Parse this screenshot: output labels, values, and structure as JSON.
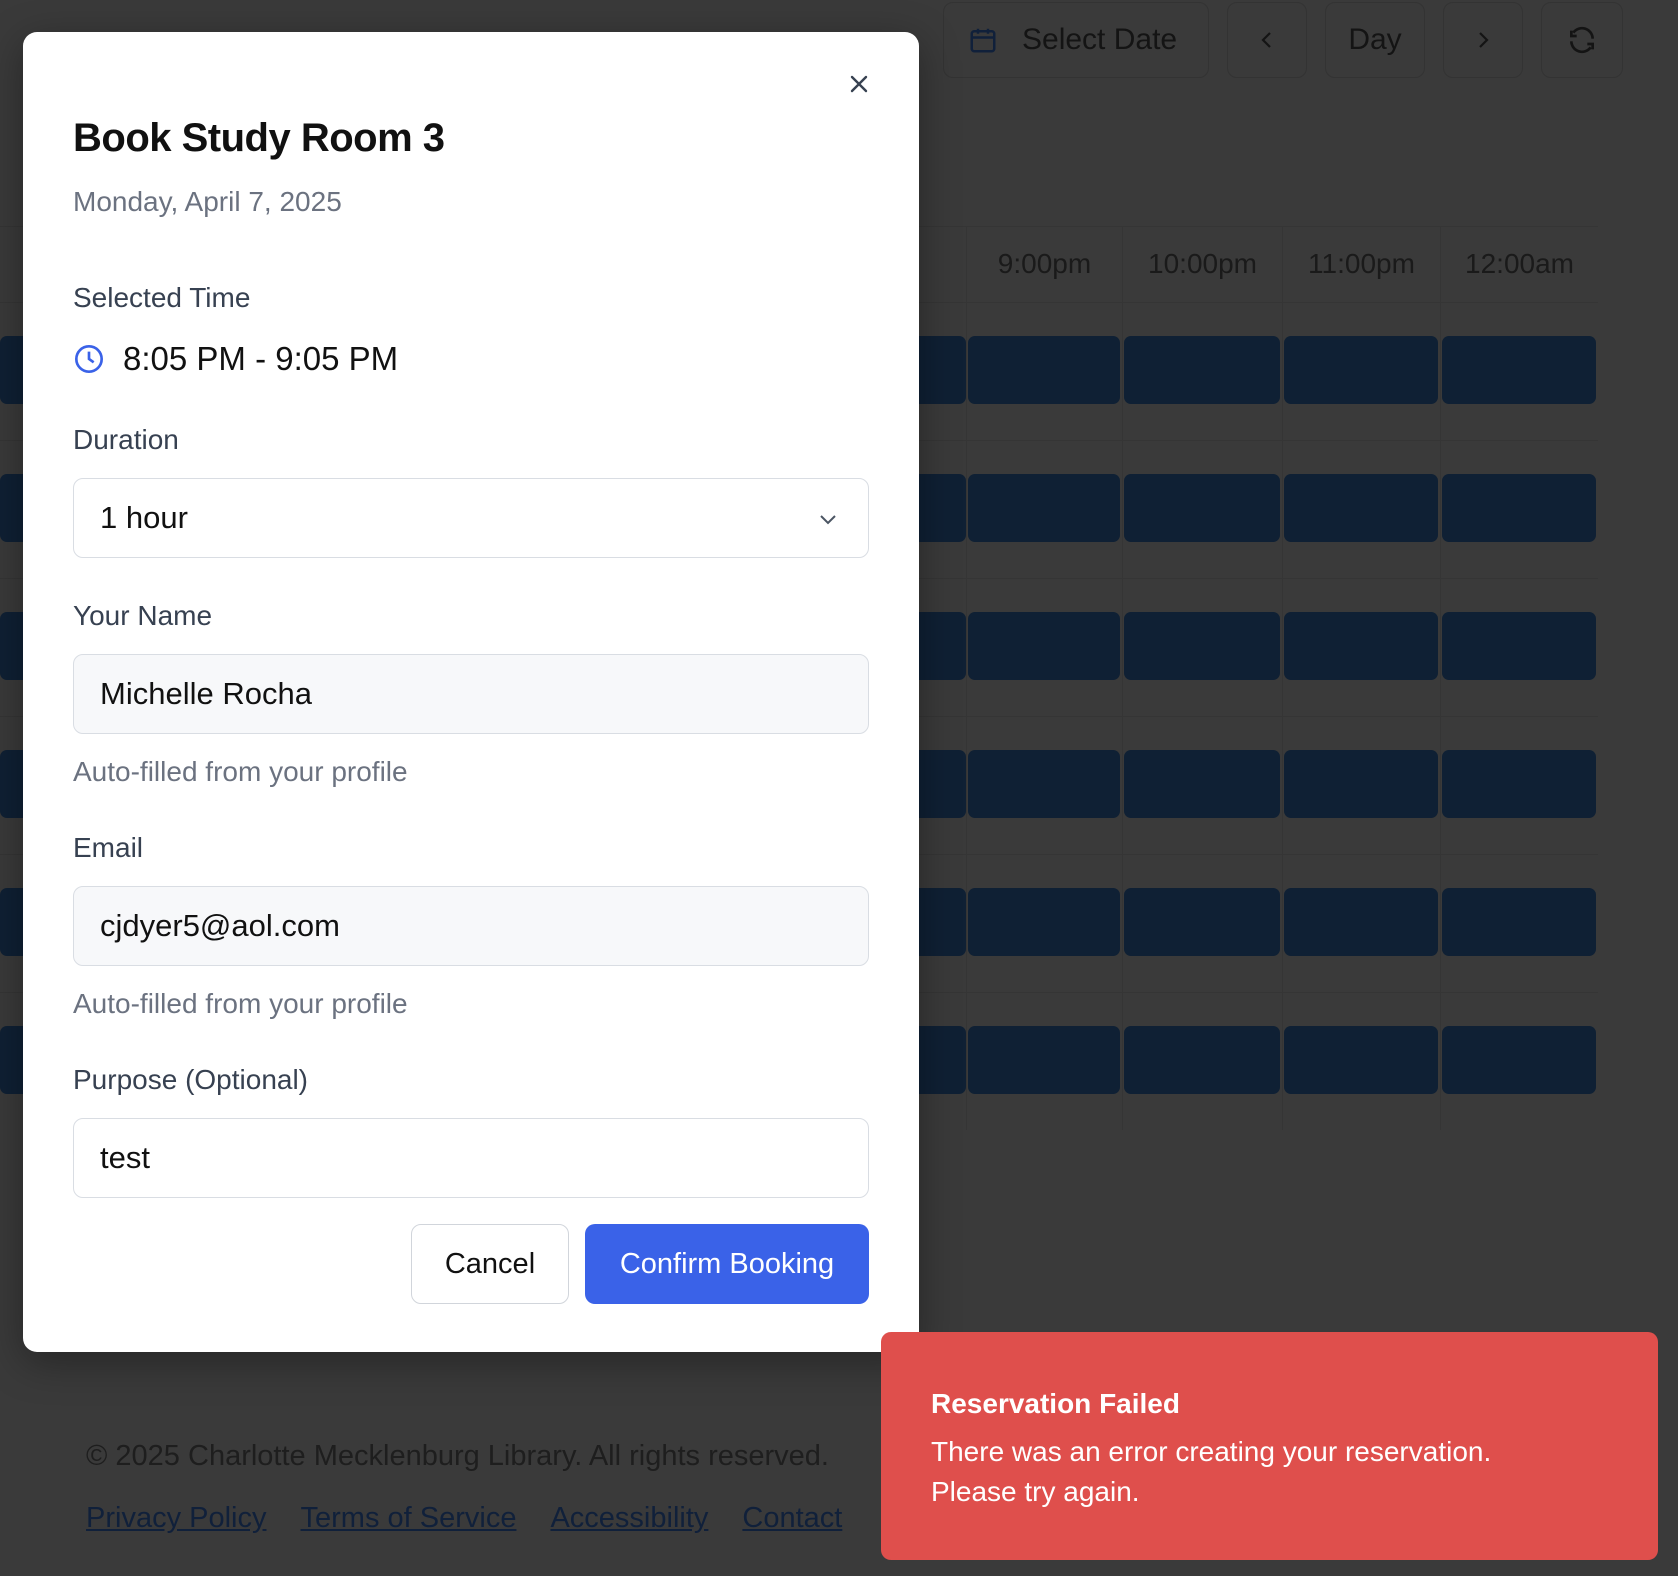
{
  "toolbar": {
    "select_date_label": "Select Date",
    "view_label": "Day"
  },
  "schedule": {
    "time_headers": [
      "m",
      "9:00pm",
      "10:00pm",
      "11:00pm",
      "12:00am"
    ]
  },
  "footer": {
    "copyright": "© 2025 Charlotte Mecklenburg Library. All rights reserved.",
    "links": [
      "Privacy Policy",
      "Terms of Service",
      "Accessibility",
      "Contact"
    ]
  },
  "modal": {
    "title": "Book Study Room 3",
    "date": "Monday, April 7, 2025",
    "selected_time_label": "Selected Time",
    "selected_time_value": "8:05 PM - 9:05 PM",
    "duration_label": "Duration",
    "duration_value": "1 hour",
    "name_label": "Your Name",
    "name_value": "Michelle Rocha",
    "name_hint": "Auto-filled from your profile",
    "email_label": "Email",
    "email_value": "cjdyer5@aol.com",
    "email_hint": "Auto-filled from your profile",
    "purpose_label": "Purpose (Optional)",
    "purpose_value": "test",
    "cancel_label": "Cancel",
    "confirm_label": "Confirm Booking"
  },
  "toast": {
    "title": "Reservation Failed",
    "message": "There was an error creating your reservation. Please try again."
  },
  "colors": {
    "accent": "#3a62e8",
    "error": "#df4f4c",
    "slot": "#0f2034"
  }
}
